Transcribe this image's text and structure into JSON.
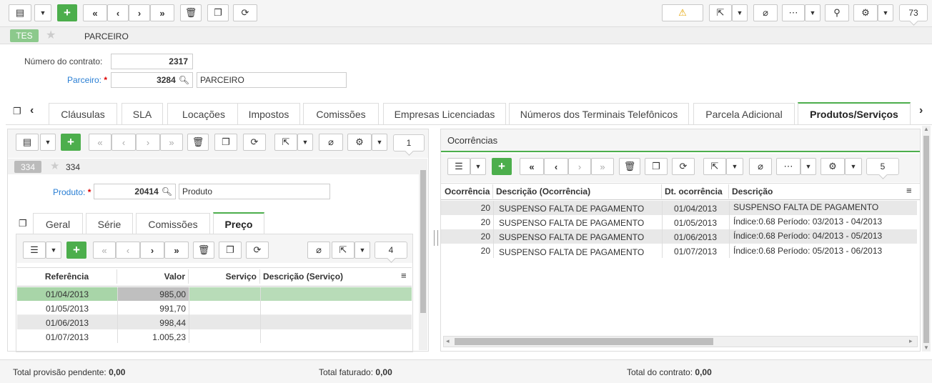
{
  "toolbar": {
    "counter": "73"
  },
  "module": {
    "badge": "TES",
    "title": "PARCEIRO"
  },
  "form": {
    "contrato_label": "Número do contrato:",
    "contrato_value": "2317",
    "parceiro_label": "Parceiro:",
    "parceiro_code": "3284",
    "parceiro_name": "PARCEIRO"
  },
  "tabs": [
    "Cláusulas",
    "SLA",
    "Locações",
    "Impostos",
    "Comissões",
    "Empresas Licenciadas",
    "Números dos Terminais Telefônicos",
    "Parcela Adicional",
    "Produtos/Serviços"
  ],
  "left": {
    "counter": "1",
    "badge": "334",
    "badge_title": "334",
    "produto_label": "Produto:",
    "produto_code": "20414",
    "produto_name": "Produto",
    "subtabs": [
      "Geral",
      "Série",
      "Comissões",
      "Preço"
    ],
    "sub_counter": "4",
    "columns": [
      "Referência",
      "Valor",
      "Serviço",
      "Descrição (Serviço)"
    ],
    "rows": [
      {
        "ref": "01/04/2013",
        "valor": "985,00",
        "servico": "",
        "desc": ""
      },
      {
        "ref": "01/05/2013",
        "valor": "991,70",
        "servico": "",
        "desc": ""
      },
      {
        "ref": "01/06/2013",
        "valor": "998,44",
        "servico": "",
        "desc": ""
      },
      {
        "ref": "01/07/2013",
        "valor": "1.005,23",
        "servico": "",
        "desc": ""
      }
    ]
  },
  "right": {
    "title": "Ocorrências",
    "counter": "5",
    "columns": [
      "Ocorrência",
      "Descrição (Ocorrência)",
      "Dt. ocorrência",
      "Descrição"
    ],
    "rows": [
      {
        "oc": "20",
        "desc_oc": "SUSPENSO FALTA DE PAGAMENTO",
        "dt": "01/04/2013",
        "desc": "SUSPENSO FALTA DE PAGAMENTO"
      },
      {
        "oc": "20",
        "desc_oc": "SUSPENSO FALTA DE PAGAMENTO",
        "dt": "01/05/2013",
        "desc": "Índice:0.68 Período: 03/2013 - 04/2013"
      },
      {
        "oc": "20",
        "desc_oc": "SUSPENSO FALTA DE PAGAMENTO",
        "dt": "01/06/2013",
        "desc": "Índice:0.68 Período: 04/2013 - 05/2013"
      },
      {
        "oc": "20",
        "desc_oc": "SUSPENSO FALTA DE PAGAMENTO",
        "dt": "01/07/2013",
        "desc": "Índice:0.68 Período: 05/2013 - 06/2013"
      }
    ]
  },
  "footer": {
    "pendente_label": "Total provisão pendente:",
    "pendente_value": "0,00",
    "faturado_label": "Total faturado:",
    "faturado_value": "0,00",
    "contrato_label": "Total do contrato:",
    "contrato_value": "0,00"
  },
  "colors": {
    "accent": "#4cae4c",
    "badge": "#8cc98c",
    "row_selected": "#a8d5a8",
    "row_alt": "#e8e8e8"
  }
}
